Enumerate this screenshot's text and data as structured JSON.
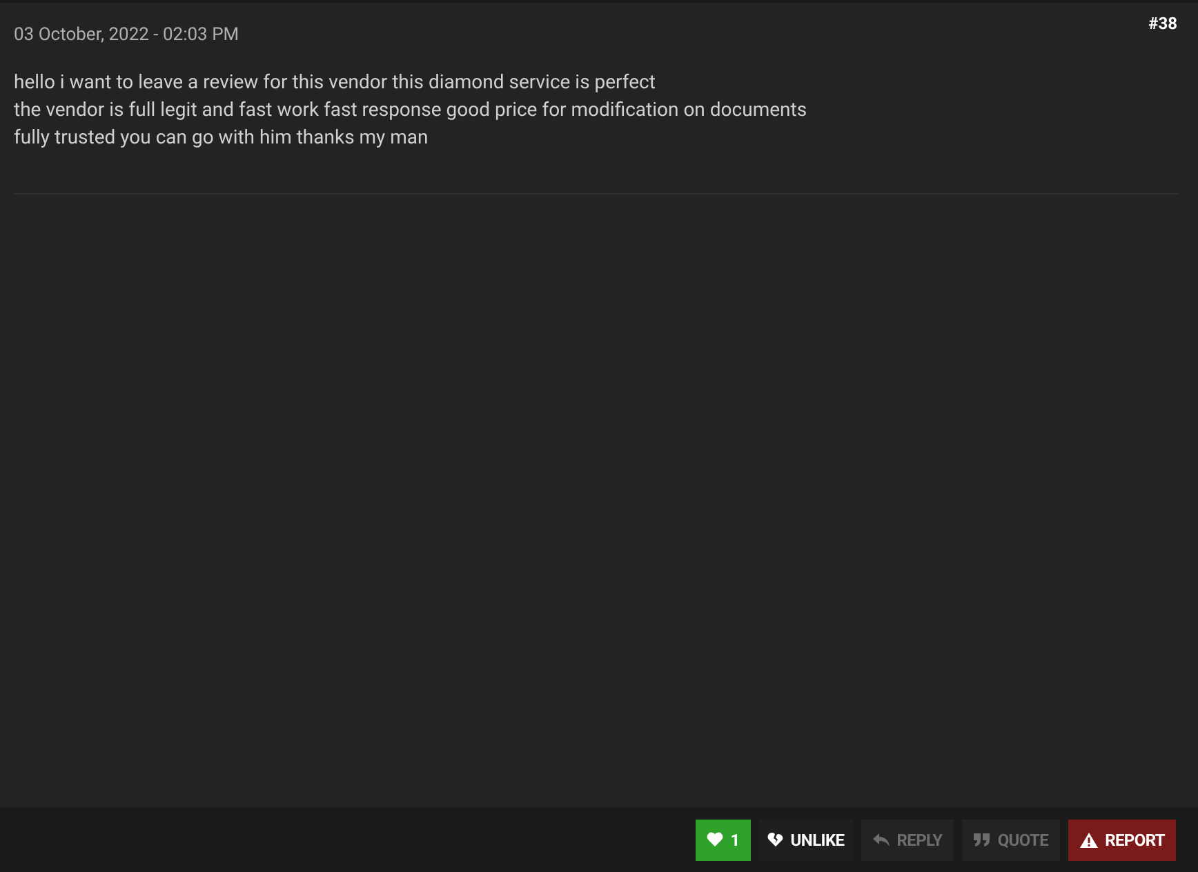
{
  "post": {
    "number": "#38",
    "date": "03 October, 2022 - 02:03 PM",
    "lines": [
      "hello i want to leave a review for this vendor this diamond service is perfect",
      "the vendor is full legit and fast work fast response good price for modification on documents",
      "fully trusted you can go with him thanks my man"
    ]
  },
  "actions": [
    {
      "kind": "like",
      "label": "1",
      "disabled": false
    },
    {
      "kind": "unlike",
      "label": "UNLIKE",
      "disabled": false
    },
    {
      "kind": "reply",
      "label": "REPLY",
      "disabled": true
    },
    {
      "kind": "quote",
      "label": "QUOTE",
      "disabled": true
    },
    {
      "kind": "report",
      "label": "REPORT",
      "disabled": false
    }
  ]
}
